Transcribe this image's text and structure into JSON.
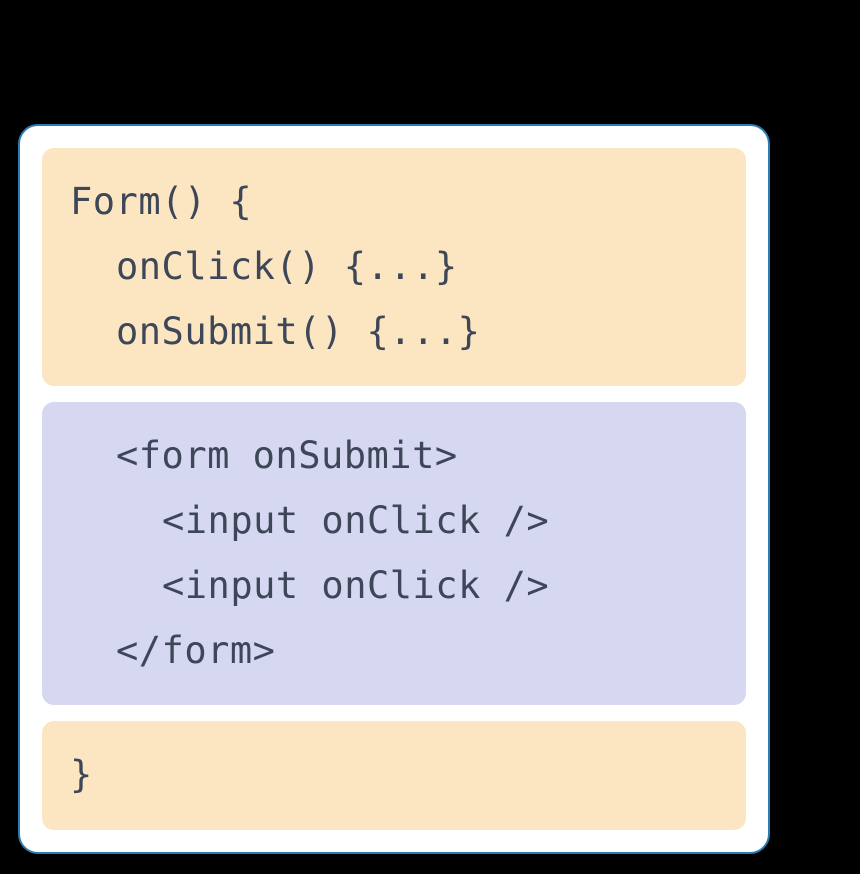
{
  "colors": {
    "card_border": "#2b7cb0",
    "card_bg": "#ffffff",
    "page_bg": "#000000",
    "block_orange": "#fce6c2",
    "block_purple": "#d6d8f1",
    "text": "#3d4758"
  },
  "blocks": [
    {
      "type": "orange",
      "lines": [
        {
          "text": "Form() {",
          "indent": 0
        },
        {
          "text": "onClick() {...}",
          "indent": 1
        },
        {
          "text": "onSubmit() {...}",
          "indent": 1
        }
      ]
    },
    {
      "type": "purple",
      "lines": [
        {
          "text": "<form onSubmit>",
          "indent": 1
        },
        {
          "text": "<input onClick />",
          "indent": 2
        },
        {
          "text": "<input onClick />",
          "indent": 2
        },
        {
          "text": "</form>",
          "indent": 1
        }
      ]
    },
    {
      "type": "orange",
      "lines": [
        {
          "text": "}",
          "indent": 0
        }
      ]
    }
  ]
}
